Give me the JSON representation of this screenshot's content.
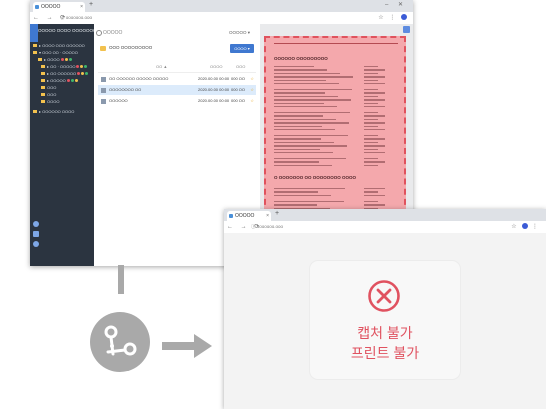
{
  "colors": {
    "accent": "#3f78d0",
    "sidebar_bg": "#2b3440",
    "preview_highlight": "#f4a8ac",
    "highlight_border": "#e0525d",
    "blocked_text": "#e05260",
    "flow_gray": "#a9a9a9"
  },
  "back_window": {
    "tab": {
      "title": "OOOOO",
      "close": "×"
    },
    "new_tab": "+",
    "window_controls": "– ✕",
    "nav": "← → ⟳",
    "url": "ⓘ ooooooo.ooo",
    "sidebar": {
      "title": "OOOOO OOOO OOOOOOOO",
      "items": [
        {
          "label": "▸ OOOO OOO OOOOOO"
        },
        {
          "label": "▾ OOO OO · OOOOO"
        },
        {
          "label": "▸ OOOO",
          "dots": [
            "#e05260",
            "#f2c14e",
            "#3fb56b"
          ]
        },
        {
          "label": "▸ OO · OOOOO",
          "dots": [
            "#e05260",
            "#f2c14e",
            "#3fb56b"
          ]
        },
        {
          "label": "▸ OO OOOOOO",
          "dots": [
            "#e05260",
            "#f2c14e",
            "#3fb56b"
          ]
        },
        {
          "label": "▸ OOOOO",
          "dots": [
            "#e05260",
            "#3fb56b",
            "#f2c14e"
          ]
        },
        {
          "label": "OOO"
        },
        {
          "label": "OOO"
        },
        {
          "label": "OOOO"
        },
        {
          "label": "▸ OOOOOO OOOO"
        }
      ]
    },
    "list": {
      "search_placeholder": "OOOOO",
      "sort_label": "OOOOO ▾",
      "folder_label": "OOO OOOOOOOOO",
      "upload_button": "OOOO ▾",
      "columns": {
        "name": "OO ▲",
        "date": "OOOO",
        "size": "OOO"
      },
      "rows": [
        {
          "name": "OO OOOOOO OOOOO OOOOO",
          "date": "2020.00.00 00:00",
          "size": "000 OO",
          "star": "☆"
        },
        {
          "name": "OOOOOOOO OO",
          "date": "2020.00.00 00:00",
          "size": "000 OO",
          "star": "☆"
        },
        {
          "name": "OOOOOO",
          "date": "2020.00.00 00:00",
          "size": "000 OO",
          "star": "☆"
        }
      ]
    },
    "preview": {
      "heading_1": "OOOOOO OOOOOOOOO",
      "heading_2": "O OOOOOOO OO OOOOOOOO OOOO"
    }
  },
  "front_window": {
    "tab": {
      "title": "OOOOO",
      "close": "×"
    },
    "new_tab": "+",
    "nav": "← → ⟳",
    "url": "ⓘ ooooooo.ooo",
    "blocked": {
      "line1": "캡처 불가",
      "line2": "프린트 불가"
    }
  }
}
